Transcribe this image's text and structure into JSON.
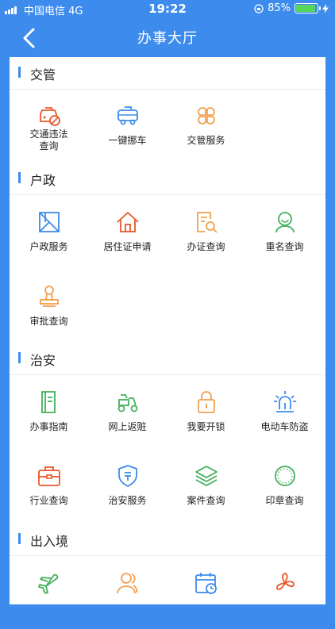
{
  "status_bar": {
    "carrier": "中国电信   4G",
    "time": "19:22",
    "battery": "85%",
    "battery_level": 0.85
  },
  "navbar": {
    "title": "办事大厅",
    "back_icon": "chevron-left-icon"
  },
  "sections": [
    {
      "title": "交管",
      "items": [
        {
          "label": "交通违法\n查询",
          "icon": "car-violation-icon",
          "color": "#e8552a"
        },
        {
          "label": "一键挪车",
          "icon": "car-move-icon",
          "color": "#3d8bec"
        },
        {
          "label": "交管服务",
          "icon": "clover-icon",
          "color": "#f0a050"
        }
      ]
    },
    {
      "title": "户政",
      "items": [
        {
          "label": "户政服务",
          "icon": "household-card-icon",
          "color": "#3d8bec"
        },
        {
          "label": "居住证申请",
          "icon": "house-icon",
          "color": "#e8552a"
        },
        {
          "label": "办证查询",
          "icon": "doc-search-icon",
          "color": "#f0a050"
        },
        {
          "label": "重名查询",
          "icon": "person-icon",
          "color": "#43b05c"
        },
        {
          "label": "审批查询",
          "icon": "stamp-icon",
          "color": "#f0a050"
        }
      ]
    },
    {
      "title": "治安",
      "items": [
        {
          "label": "办事指南",
          "icon": "guide-book-icon",
          "color": "#43b05c"
        },
        {
          "label": "网上返赃",
          "icon": "scooter-icon",
          "color": "#43b05c"
        },
        {
          "label": "我要开锁",
          "icon": "lock-icon",
          "color": "#f0a050"
        },
        {
          "label": "电动车防盗",
          "icon": "alarm-light-icon",
          "color": "#3d8bec"
        },
        {
          "label": "行业查询",
          "icon": "briefcase-icon",
          "color": "#e8552a"
        },
        {
          "label": "治安服务",
          "icon": "shield-icon",
          "color": "#3d8bec"
        },
        {
          "label": "案件查询",
          "icon": "layers-icon",
          "color": "#43b05c"
        },
        {
          "label": "印章查询",
          "icon": "seal-icon",
          "color": "#43b05c"
        }
      ]
    },
    {
      "title": "出入境",
      "items": [
        {
          "label": "",
          "icon": "airplane-icon",
          "color": "#43b05c"
        },
        {
          "label": "",
          "icon": "people-icon",
          "color": "#f0a050"
        },
        {
          "label": "",
          "icon": "calendar-clock-icon",
          "color": "#3d8bec"
        },
        {
          "label": "",
          "icon": "pinwheel-icon",
          "color": "#e8552a"
        }
      ]
    }
  ]
}
